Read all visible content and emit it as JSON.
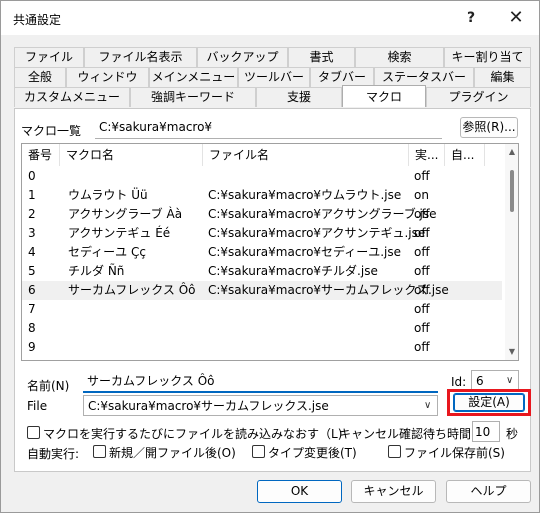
{
  "window": {
    "title": "共通設定",
    "help_glyph": "?",
    "close_glyph": "✕"
  },
  "tabs": {
    "row1": [
      "ファイル",
      "ファイル名表示",
      "バックアップ",
      "書式",
      "検索",
      "キー割り当て"
    ],
    "row2": [
      "全般",
      "ウィンドウ",
      "メインメニュー",
      "ツールバー",
      "タブバー",
      "ステータスバー",
      "編集"
    ],
    "row3": [
      "カスタムメニュー",
      "強調キーワード",
      "支援",
      "マクロ",
      "プラグイン"
    ],
    "active": "マクロ"
  },
  "macro_dir": {
    "label": "マクロ一覧",
    "value": "C:¥sakura¥macro¥",
    "browse_label": "参照(R)..."
  },
  "list": {
    "headers": [
      "番号",
      "マクロ名",
      "ファイル名",
      "実...",
      "自..."
    ],
    "rows": [
      {
        "num": "0",
        "name": "",
        "file": "",
        "exec": "off",
        "auto": ""
      },
      {
        "num": "1",
        "name": "ウムラウト Üü",
        "file": "C:¥sakura¥macro¥ウムラウト.jse",
        "exec": "on",
        "auto": ""
      },
      {
        "num": "2",
        "name": "アクサングラーブ Àà",
        "file": "C:¥sakura¥macro¥アクサングラーブ.jse",
        "exec": "off",
        "auto": ""
      },
      {
        "num": "3",
        "name": "アクサンテギュ Éé",
        "file": "C:¥sakura¥macro¥アクサンテギュ.jse",
        "exec": "off",
        "auto": ""
      },
      {
        "num": "4",
        "name": "セディーユ Çç",
        "file": "C:¥sakura¥macro¥セディーユ.jse",
        "exec": "off",
        "auto": ""
      },
      {
        "num": "5",
        "name": "チルダ Ññ",
        "file": "C:¥sakura¥macro¥チルダ.jse",
        "exec": "off",
        "auto": ""
      },
      {
        "num": "6",
        "name": "サーカムフレックス Ôô",
        "file": "C:¥sakura¥macro¥サーカムフレックス.jse",
        "exec": "off",
        "auto": ""
      },
      {
        "num": "7",
        "name": "",
        "file": "",
        "exec": "off",
        "auto": ""
      },
      {
        "num": "8",
        "name": "",
        "file": "",
        "exec": "off",
        "auto": ""
      },
      {
        "num": "9",
        "name": "",
        "file": "",
        "exec": "off",
        "auto": ""
      }
    ],
    "selected_index": 6
  },
  "name_field": {
    "label": "名前(N)",
    "value": "サーカムフレックス Ôô"
  },
  "id_field": {
    "label": "Id:",
    "value": "6"
  },
  "file_field": {
    "label": "File",
    "value": "C:¥sakura¥macro¥サーカムフレックス.jse"
  },
  "set_button": "設定(A)",
  "reload_option": {
    "label": "マクロを実行するたびにファイルを読み込みなおす（L)",
    "checked": false
  },
  "cancel_wait": {
    "label": "キャンセル確認待ち時間",
    "value": "10",
    "unit": "秒"
  },
  "auto_exec": {
    "label": "自動実行:",
    "options": [
      {
        "label": "新規／開ファイル後(O)",
        "checked": false
      },
      {
        "label": "タイプ変更後(T)",
        "checked": false
      },
      {
        "label": "ファイル保存前(S)",
        "checked": false
      }
    ]
  },
  "footer": {
    "ok": "OK",
    "cancel": "キャンセル",
    "help": "ヘルプ"
  },
  "colors": {
    "accent": "#0067c0",
    "highlight": "#e8171e"
  }
}
